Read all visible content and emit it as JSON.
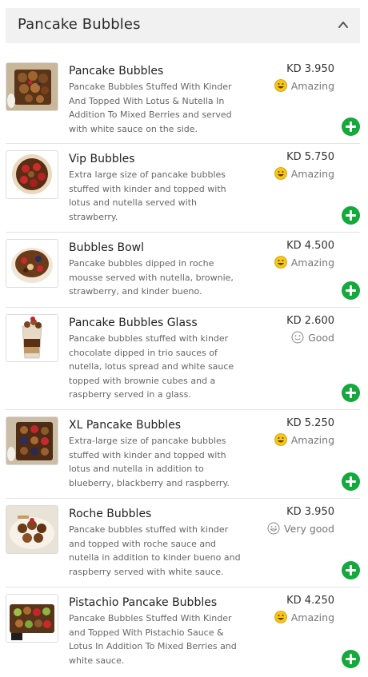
{
  "section": {
    "title": "Pancake Bubbles"
  },
  "items": [
    {
      "name": "Pancake Bubbles",
      "description": "Pancake Bubbles Stuffed With Kinder And Topped With Lotus & Nutella In Addition To Mixed Berries and served with white sauce on the side.",
      "price": "KD 3.950",
      "rating": "Amazing",
      "rating_icon": "happy-face-icon"
    },
    {
      "name": "Vip Bubbles",
      "description": "Extra large size of pancake bubbles stuffed with kinder and topped with lotus and nutella served with strawberry.",
      "price": "KD 5.750",
      "rating": "Amazing",
      "rating_icon": "happy-face-icon"
    },
    {
      "name": "Bubbles Bowl",
      "description": "Pancake bubbles dipped in roche mousse served with nutella, brownie, strawberry, and kinder bueno.",
      "price": "KD 4.500",
      "rating": "Amazing",
      "rating_icon": "happy-face-icon"
    },
    {
      "name": "Pancake Bubbles Glass",
      "description": "Pancake bubbles stuffed with kinder chocolate dipped in trio sauces of nutella, lotus spread and white sauce topped with brownie cubes and a raspberry served in a glass.",
      "price": "KD 2.600",
      "rating": "Good",
      "rating_icon": "smile-outline-icon"
    },
    {
      "name": "XL Pancake Bubbles",
      "description": "Extra-large size of pancake bubbles stuffed with kinder and topped with lotus and nutella in addition to blueberry, blackberry and raspberry.",
      "price": "KD 5.250",
      "rating": "Amazing",
      "rating_icon": "happy-face-icon"
    },
    {
      "name": "Roche Bubbles",
      "description": "Pancake bubbles stuffed with kinder and topped with roche sauce and nutella in addition to kinder bueno and raspberry served with white sauce.",
      "price": "KD 3.950",
      "rating": "Very good",
      "rating_icon": "grin-outline-icon"
    },
    {
      "name": "Pistachio Pancake Bubbles",
      "description": "Pancake Bubbles Stuffed With Kinder and Topped With Pistachio Sauce & Lotus In Addition To Mixed Berries and white sauce.",
      "price": "KD 4.250",
      "rating": "Amazing",
      "rating_icon": "happy-face-icon"
    }
  ],
  "colors": {
    "accent": "#14a83d",
    "header_bg": "#f1f1f1",
    "emoji_yellow": "#f5c518"
  }
}
